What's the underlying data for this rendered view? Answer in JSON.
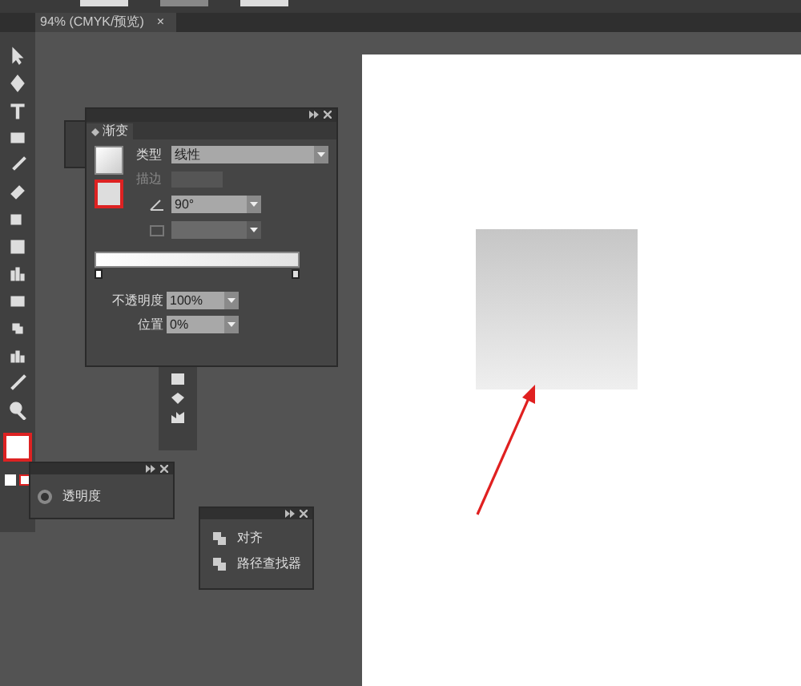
{
  "document_tab": {
    "title": "94% (CMYK/预览)",
    "close": "×"
  },
  "gradient_panel": {
    "title": "渐变",
    "type_label": "类型",
    "type_value": "线性",
    "stroke_label": "描边",
    "stroke_disabled": true,
    "angle": "90°",
    "aspect_disabled": true,
    "opacity_label": "不透明度",
    "opacity": "100%",
    "location_label": "位置",
    "location": "0%"
  },
  "transparency_panel": {
    "label": "透明度"
  },
  "align_panel": {
    "items": [
      {
        "label": "对齐"
      },
      {
        "label": "路径查找器"
      }
    ]
  }
}
